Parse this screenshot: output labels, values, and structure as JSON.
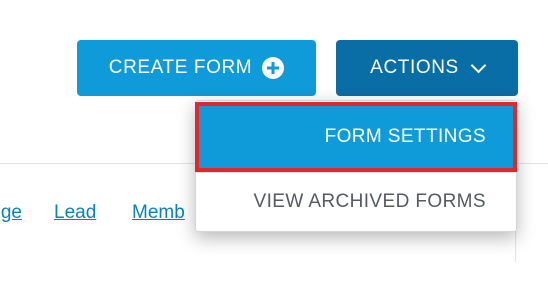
{
  "header": {
    "create_form_label": "CREATE FORM",
    "actions_label": "ACTIONS"
  },
  "tabs": [
    {
      "label": "ge"
    },
    {
      "label": "Lead"
    },
    {
      "label": "Memb"
    }
  ],
  "dropdown": {
    "items": [
      {
        "label": "FORM SETTINGS",
        "highlighted": true
      },
      {
        "label": "VIEW ARCHIVED FORMS",
        "highlighted": false
      }
    ]
  },
  "colors": {
    "primary": "#0f9ad9",
    "actions_bg": "#0a6ea6",
    "highlight_border": "#e2262a",
    "link": "#0a7fc2"
  },
  "icons": {
    "create_form": "plus-circle-icon",
    "actions": "chevron-down-icon"
  }
}
